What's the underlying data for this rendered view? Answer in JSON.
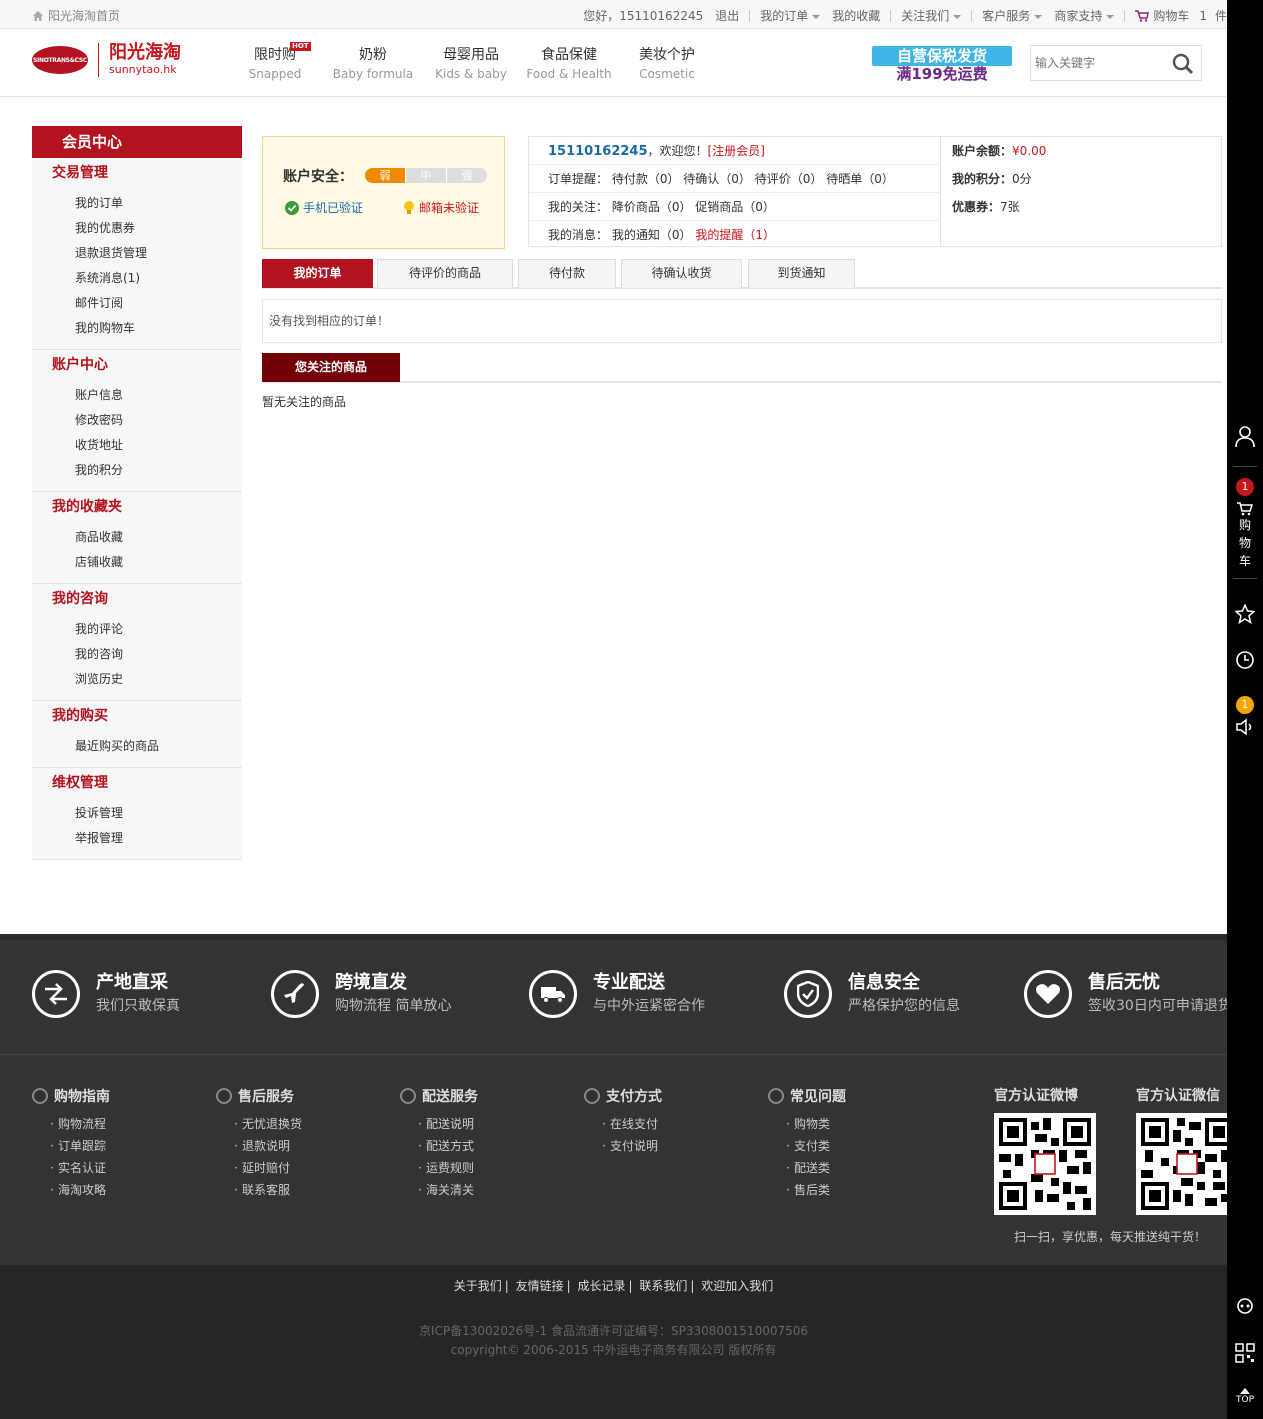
{
  "topbar": {
    "home": "阳光海淘首页",
    "greeting": "您好，15110162245",
    "logout": "退出",
    "my_orders": "我的订单",
    "my_favorites": "我的收藏",
    "follow_us": "关注我们",
    "customer_service": "客户服务",
    "merchant_support": "商家支持",
    "cart": "购物车",
    "cart_count": "1",
    "cart_unit": "件"
  },
  "logo": {
    "badge": "SINOTRANS&CSC",
    "cn": "阳光海淘",
    "en": "sunnytao.hk"
  },
  "nav": [
    {
      "cn": "限时购",
      "en": "Snapped",
      "hot": "HOT"
    },
    {
      "cn": "奶粉",
      "en": "Baby formula"
    },
    {
      "cn": "母婴用品",
      "en": "Kids & baby"
    },
    {
      "cn": "食品保健",
      "en": "Food & Health"
    },
    {
      "cn": "美妆个护",
      "en": "Cosmetic"
    }
  ],
  "promo": {
    "line1": "自营保税发货",
    "line2": "满199免运费"
  },
  "search": {
    "placeholder": "输入关键字"
  },
  "sidebar": {
    "title": "会员中心",
    "groups": [
      {
        "title": "交易管理",
        "items": [
          "我的订单",
          "我的优惠券",
          "退款退货管理",
          "系统消息(1)",
          "邮件订阅",
          "我的购物车"
        ]
      },
      {
        "title": "账户中心",
        "items": [
          "账户信息",
          "修改密码",
          "收货地址",
          "我的积分"
        ]
      },
      {
        "title": "我的收藏夹",
        "items": [
          "商品收藏",
          "店铺收藏"
        ]
      },
      {
        "title": "我的咨询",
        "items": [
          "我的评论",
          "我的咨询",
          "浏览历史"
        ]
      },
      {
        "title": "我的购买",
        "items": [
          "最近购买的商品"
        ]
      },
      {
        "title": "维权管理",
        "items": [
          "投诉管理",
          "举报管理"
        ]
      }
    ]
  },
  "security": {
    "label": "账户安全：",
    "levels": [
      "弱",
      "中",
      "强"
    ],
    "level_value": 1,
    "phone": "手机已验证",
    "mail": "邮箱未验证"
  },
  "info": {
    "username": "15110162245",
    "welcome": "，欢迎您！",
    "member": "[注册会员]",
    "reminder_label": "订单提醒：",
    "reminders": "待付款（0） 待确认（0） 待评价（0） 待晒单（0）",
    "follow_label": "我的关注：",
    "follows": "降价商品（0） 促销商品（0）",
    "msg_label": "我的消息：",
    "notice": "我的通知（0）",
    "remind": "我的提醒（1）",
    "balance_label": "账户余额：",
    "balance": "¥0.00",
    "points_label": "我的积分：",
    "points": "0分",
    "coupon_label": "优惠券：",
    "coupons": "7张"
  },
  "tabs": [
    "我的订单",
    "待评价的商品",
    "待付款",
    "待确认收货",
    "到货通知"
  ],
  "orders_empty": "没有找到相应的订单！",
  "fav": {
    "title": "您关注的商品",
    "empty": "暂无关注的商品"
  },
  "features": [
    {
      "t": "产地直采",
      "s": "我们只敢保真"
    },
    {
      "t": "跨境直发",
      "s": "购物流程 简单放心"
    },
    {
      "t": "专业配送",
      "s": "与中外运紧密合作"
    },
    {
      "t": "信息安全",
      "s": "严格保护您的信息"
    },
    {
      "t": "售后无忧",
      "s": "签收30日内可申请退货"
    }
  ],
  "footer_cols": [
    {
      "t": "购物指南",
      "items": [
        "购物流程",
        "订单跟踪",
        "实名认证",
        "海淘攻略"
      ]
    },
    {
      "t": "售后服务",
      "items": [
        "无忧退换货",
        "退款说明",
        "延时赔付",
        "联系客服"
      ]
    },
    {
      "t": "配送服务",
      "items": [
        "配送说明",
        "配送方式",
        "运费规则",
        "海关清关"
      ]
    },
    {
      "t": "支付方式",
      "items": [
        "在线支付",
        "支付说明"
      ]
    },
    {
      "t": "常见问题",
      "items": [
        "购物类",
        "支付类",
        "配送类",
        "售后类"
      ]
    }
  ],
  "qr": {
    "weibo": "官方认证微博",
    "weixin": "官方认证微信",
    "note": "扫一扫，享优惠，每天推送纯干货！"
  },
  "copy": {
    "links": [
      "关于我们",
      "友情链接",
      "成长记录",
      "联系我们",
      "欢迎加入我们"
    ],
    "icp": "京ICP备13002026号-1   食品流通许可证编号：SP3308001510007506",
    "copyright": "copyright© 2006-2015 中外运电子商务有限公司  版权所有"
  },
  "rbar": {
    "cart_count": "1",
    "cart_label": "购物车",
    "msg_count": "1",
    "top": "TOP"
  }
}
